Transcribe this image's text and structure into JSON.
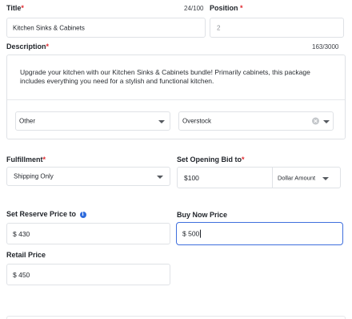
{
  "title": {
    "label": "Title",
    "required_marker": "*",
    "counter": "24/100",
    "value": "Kitchen Sinks & Cabinets"
  },
  "position": {
    "label": "Position",
    "required_marker": "*",
    "placeholder": "2"
  },
  "description": {
    "label": "Description",
    "required_marker": "*",
    "counter": "163/3000",
    "text": "Upgrade your kitchen with our Kitchen Sinks & Cabinets bundle! Primarily cabinets, this package includes everything you need for a stylish and functional kitchen."
  },
  "category_select": {
    "value": "Other"
  },
  "condition_select": {
    "value": "Overstock"
  },
  "fulfillment": {
    "label": "Fulfillment",
    "required_marker": "*",
    "value": "Shipping Only"
  },
  "opening_bid": {
    "label": "Set Opening Bid to",
    "required_marker": "*",
    "value": "$100",
    "type_value": "Dollar Amount"
  },
  "reserve_price": {
    "label": "Set Reserve Price to",
    "info_glyph": "i",
    "value": "$ 430"
  },
  "buy_now_price": {
    "label": "Buy Now Price",
    "value": "$ 500"
  },
  "retail_price": {
    "label": "Retail Price",
    "value": "$ 450"
  },
  "colors": {
    "required": "#e0282e",
    "focus_border": "#3f6fdd",
    "info_icon": "#2f6bdc",
    "field_border": "#dfe2e6"
  },
  "icons": [
    "chevron-down-icon",
    "clear-icon",
    "info-icon"
  ]
}
